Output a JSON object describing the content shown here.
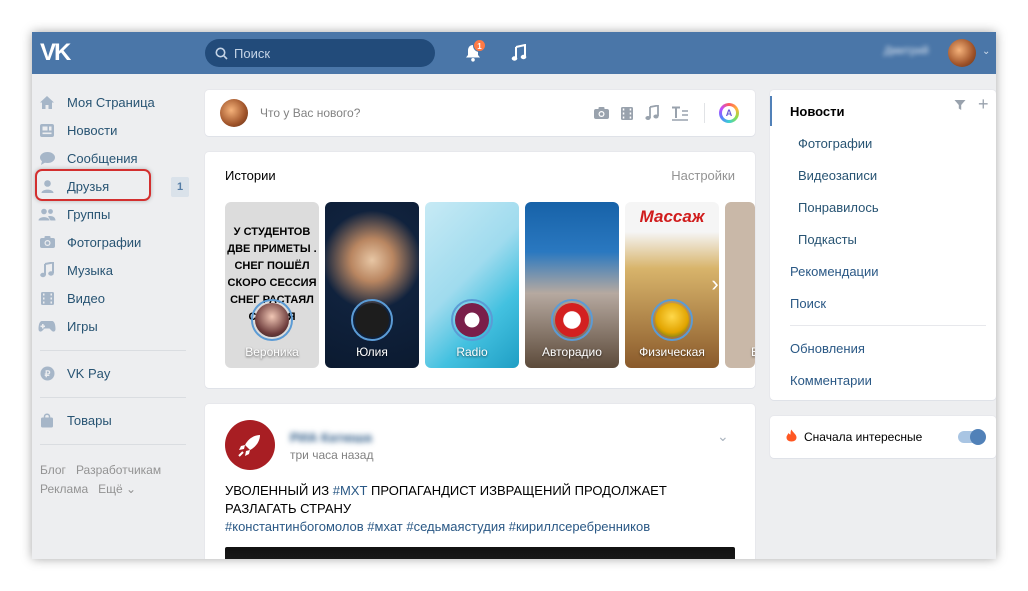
{
  "header": {
    "logo": "VK",
    "search_placeholder": "Поиск",
    "notifications_count": "1",
    "user_name": "Дмитрий"
  },
  "sidebar": {
    "items": [
      {
        "label": "Моя Страница",
        "icon": "home-icon"
      },
      {
        "label": "Новости",
        "icon": "news-icon"
      },
      {
        "label": "Сообщения",
        "icon": "messages-icon"
      },
      {
        "label": "Друзья",
        "icon": "friends-icon",
        "badge": "1"
      },
      {
        "label": "Группы",
        "icon": "groups-icon"
      },
      {
        "label": "Фотографии",
        "icon": "camera-icon"
      },
      {
        "label": "Музыка",
        "icon": "music-icon"
      },
      {
        "label": "Видео",
        "icon": "video-icon"
      },
      {
        "label": "Игры",
        "icon": "gamepad-icon"
      }
    ],
    "vkpay": "VK Pay",
    "goods": "Товары",
    "footer": [
      "Блог",
      "Разработчикам",
      "Реклама",
      "Ещё"
    ]
  },
  "compose": {
    "placeholder": "Что у Вас нового?"
  },
  "stories": {
    "title": "Истории",
    "settings": "Настройки",
    "items": [
      {
        "name": "Вероника",
        "text": "У СТУДЕНТОВ ДВЕ ПРИМЕТЫ . СНЕГ ПОШЁЛ СКОРО СЕССИЯ СНЕГ РАСТАЯЛ СЕССИЯ"
      },
      {
        "name": "Юлия"
      },
      {
        "name": "Radio"
      },
      {
        "name": "Авторадио"
      },
      {
        "name": "Физическая",
        "text": "Массаж"
      },
      {
        "name": "Е"
      }
    ]
  },
  "post": {
    "author": "РИА Катюша",
    "time": "три часа назад",
    "text_pre": "УВОЛЕННЫЙ ИЗ ",
    "text_tag": "#МХТ",
    "text_post": " ПРОПАГАНДИСТ ИЗВРАЩЕНИЙ ПРОДОЛЖАЕТ РАЗЛАГАТЬ СТРАНУ",
    "hashtags": "#константинбогомолов #мхат #седьмаястудия #кириллсеребренников"
  },
  "right_panel": {
    "news": "Новости",
    "sub_items": [
      "Фотографии",
      "Видеозаписи",
      "Понравилось",
      "Подкасты"
    ],
    "recommendations": "Рекомендации",
    "search": "Поиск",
    "updates": "Обновления",
    "comments": "Комментарии"
  },
  "interesting": {
    "label": "Сначала интересные",
    "enabled": true
  },
  "colors": {
    "header": "#4a76a8",
    "link": "#2a5885",
    "highlight": "#d32f2f"
  }
}
